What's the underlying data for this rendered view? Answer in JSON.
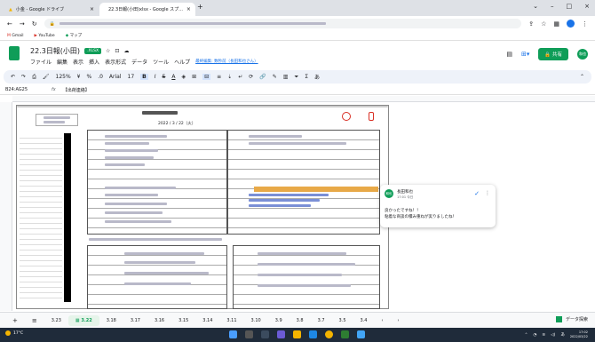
{
  "browser": {
    "tabs": [
      {
        "title": "小金 - Google ドライブ",
        "active": false
      },
      {
        "title": "22.3日報(小田)xlsx - Google スプ...",
        "active": true
      }
    ],
    "bookmarks": [
      "Gmail",
      "YouTube",
      "マップ"
    ]
  },
  "doc": {
    "title": "22.3日報(小田)",
    "badge": ".XLSX",
    "menus": [
      "ファイル",
      "編集",
      "表示",
      "挿入",
      "表示形式",
      "データ",
      "ツール",
      "ヘルプ"
    ],
    "last_edit": "最終編集: 数秒前（長田和也さん）",
    "share_label": "共有",
    "avatar": "和也"
  },
  "toolbar": {
    "zoom": "125%",
    "font": "Arial",
    "size": "17"
  },
  "formula": {
    "cell_ref": "B24:AG25",
    "fx": "fx",
    "value": "【出荷連絡】"
  },
  "sheet": {
    "date": "2022 / 3 / 22（火）"
  },
  "comment": {
    "avatar": "和也",
    "name": "長田和也",
    "time": "17:01 今日",
    "line1": "良かったですね！！",
    "line2": "粘着な商談の積み重ねが実りましたね！"
  },
  "sheet_tabs": {
    "items": [
      "3.23",
      "3.22",
      "3.18",
      "3.17",
      "3.16",
      "3.15",
      "3.14",
      "3.11",
      "3.10",
      "3.9",
      "3.8",
      "3.7",
      "3.5",
      "3.4"
    ],
    "active_index": 1,
    "explore_label": "データ探索"
  },
  "taskbar": {
    "temperature": "17°C",
    "time": "17:02",
    "date": "2022/03/22"
  },
  "colors": {
    "sheets_green": "#0f9d58",
    "accent_blue": "#1a73e8",
    "stamp_red": "#d93025"
  }
}
